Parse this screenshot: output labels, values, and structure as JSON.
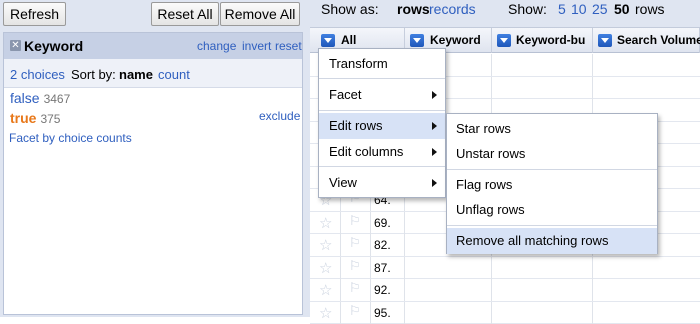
{
  "toolbar": {
    "refresh": "Refresh",
    "reset_all": "Reset All",
    "remove_all": "Remove All"
  },
  "facet": {
    "title": "Keyword",
    "links": {
      "change": "change",
      "invert": "invert",
      "reset": "reset"
    },
    "choices_count": "2 choices",
    "sort_label": "Sort by:",
    "sort_name": "name",
    "sort_count": "count",
    "choices": [
      {
        "name": "false",
        "count": "3467"
      },
      {
        "name": "true",
        "count": "375"
      }
    ],
    "exclude": "exclude",
    "facet_by_counts": "Facet by choice counts"
  },
  "view": {
    "show_as_label": "Show as:",
    "rows": "rows",
    "records": "records",
    "show_label": "Show:",
    "page_sizes": [
      "5",
      "10",
      "25",
      "50"
    ],
    "selected_page_size": "50",
    "rows_suffix": "rows"
  },
  "columns": [
    {
      "label": "All"
    },
    {
      "label": "Keyword"
    },
    {
      "label": "Keyword-bu"
    },
    {
      "label": "Search Volume"
    }
  ],
  "rows": [
    {
      "num": ""
    },
    {
      "num": ""
    },
    {
      "num": ""
    },
    {
      "num": ""
    },
    {
      "num": ""
    },
    {
      "num": ""
    },
    {
      "num": "64."
    },
    {
      "num": "69."
    },
    {
      "num": "82."
    },
    {
      "num": "87."
    },
    {
      "num": "92."
    },
    {
      "num": "95."
    }
  ],
  "menu": {
    "items": [
      {
        "label": "Transform"
      },
      {
        "label": "Facet"
      },
      {
        "label": "Edit rows"
      },
      {
        "label": "Edit columns"
      },
      {
        "label": "View"
      }
    ]
  },
  "submenu": {
    "items": [
      {
        "label": "Star rows"
      },
      {
        "label": "Unstar rows"
      },
      {
        "label": "Flag rows"
      },
      {
        "label": "Unflag rows"
      },
      {
        "label": "Remove all matching rows"
      }
    ]
  },
  "colors": {
    "panel_bg": "#dfe5f1",
    "link": "#2f5fbf",
    "true_choice": "#e8781a",
    "menu_highlight": "#d7e2f6"
  },
  "icons": {
    "star": "star-icon",
    "flag": "flag-icon",
    "close": "close-icon",
    "dropdown": "dropdown-icon"
  }
}
